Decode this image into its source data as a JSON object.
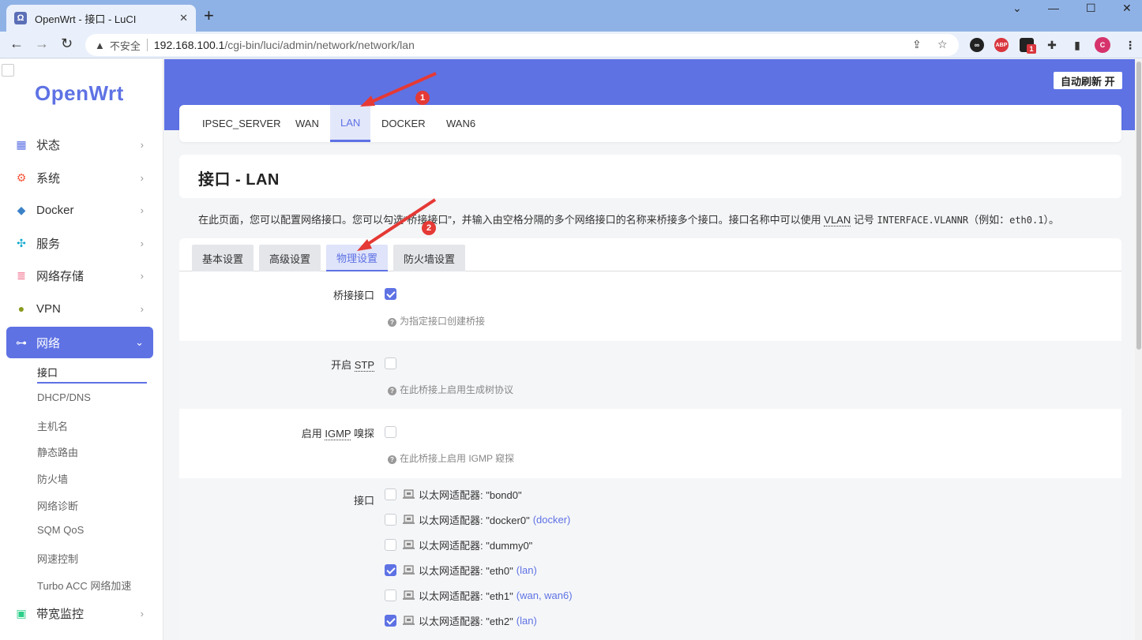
{
  "browser": {
    "tab_title": "OpenWrt - 接口 - LuCI",
    "tab_favicon": "Ω",
    "insecure_label": "不安全",
    "url_host": "192.168.100.1",
    "url_path": "/cgi-bin/luci/admin/network/network/lan",
    "profile_initial": "C",
    "ext_badge": "1",
    "ext_abp": "ABP"
  },
  "sidebar": {
    "logo": "OpenWrt",
    "items": [
      {
        "label": "状态",
        "icon": "dashboard-icon"
      },
      {
        "label": "系统",
        "icon": "gear-icon"
      },
      {
        "label": "Docker",
        "icon": "docker-icon"
      },
      {
        "label": "服务",
        "icon": "services-icon"
      },
      {
        "label": "网络存储",
        "icon": "storage-icon"
      },
      {
        "label": "VPN",
        "icon": "vpn-icon"
      },
      {
        "label": "网络",
        "icon": "network-icon"
      }
    ],
    "submenu": [
      "接口",
      "DHCP/DNS",
      "主机名",
      "静态路由",
      "防火墙",
      "网络诊断",
      "SQM QoS",
      "网速控制",
      "Turbo ACC 网络加速"
    ],
    "bottom_item": {
      "label": "带宽监控",
      "icon": "bandwidth-icon"
    }
  },
  "header": {
    "refresh_label": "自动刷新 开"
  },
  "iface_tabs": [
    "IPSEC_SERVER",
    "WAN",
    "LAN",
    "DOCKER",
    "WAN6"
  ],
  "page": {
    "title": "接口 - LAN",
    "desc_before": "在此页面，您可以配置网络接口。您可以勾选“桥接接口”，并输入由空格分隔的多个网络接口的名称来桥接多个接口。接口名称中可以使用 ",
    "desc_abbr": "VLAN",
    "desc_middle": " 记号 ",
    "desc_code1": "INTERFACE.VLANNR",
    "desc_paren": "（例如：",
    "desc_code2": "eth0.1",
    "desc_end": "）。"
  },
  "subtabs": [
    "基本设置",
    "高级设置",
    "物理设置",
    "防火墙设置"
  ],
  "form": {
    "bridge": {
      "label": "桥接接口",
      "checked": true,
      "hint": "为指定接口创建桥接"
    },
    "stp": {
      "label_prefix": "开启 ",
      "label_abbr": "STP",
      "checked": false,
      "hint": "在此桥接上启用生成树协议"
    },
    "igmp": {
      "label_prefix": "启用 ",
      "label_abbr": "IGMP",
      "label_suffix": " 嗅探",
      "checked": false,
      "hint": "在此桥接上启用 IGMP 窥探"
    },
    "interfaces_label": "接口",
    "interfaces": [
      {
        "text": "以太网适配器: \"bond0\"",
        "zones": "",
        "checked": false
      },
      {
        "text": "以太网适配器: \"docker0\"",
        "zones": "(docker)",
        "checked": false
      },
      {
        "text": "以太网适配器: \"dummy0\"",
        "zones": "",
        "checked": false
      },
      {
        "text": "以太网适配器: \"eth0\"",
        "zones": "(lan)",
        "checked": true
      },
      {
        "text": "以太网适配器: \"eth1\"",
        "zones": "(wan, wan6)",
        "checked": false
      },
      {
        "text": "以太网适配器: \"eth2\"",
        "zones": "(lan)",
        "checked": true
      }
    ]
  },
  "annotations": [
    "1",
    "2"
  ],
  "colors": {
    "accent": "#5e72e4",
    "annotation": "#e53935"
  }
}
